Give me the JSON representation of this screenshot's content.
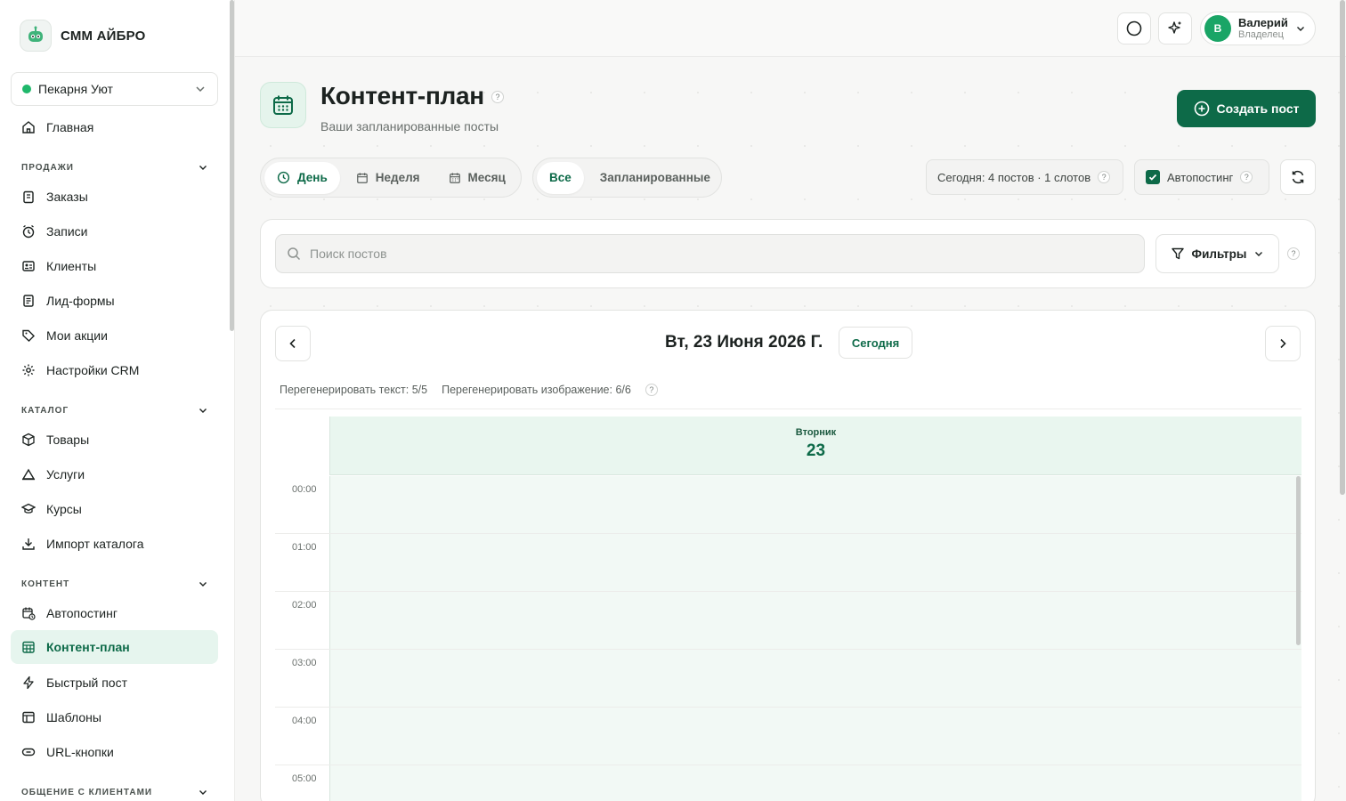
{
  "brand": {
    "name": "СММ АЙБРО"
  },
  "shop": {
    "name": "Пекарня Уют"
  },
  "nav": {
    "home": "Главная",
    "sections": {
      "sales": "ПРОДАЖИ",
      "catalog": "КАТАЛОГ",
      "content": "КОНТЕНТ",
      "clients": "ОБЩЕНИЕ С КЛИЕНТАМИ"
    },
    "sales_items": [
      "Заказы",
      "Записи",
      "Клиенты",
      "Лид-формы",
      "Мои акции",
      "Настройки CRM"
    ],
    "catalog_items": [
      "Товары",
      "Услуги",
      "Курсы",
      "Импорт каталога"
    ],
    "content_items": [
      "Автопостинг",
      "Контент-план",
      "Быстрый пост",
      "Шаблоны",
      "URL-кнопки"
    ],
    "active": "Контент-план"
  },
  "user": {
    "initial": "В",
    "name": "Валерий",
    "role": "Владелец"
  },
  "page": {
    "title": "Контент-план",
    "subtitle": "Ваши запланированные посты",
    "help": "?",
    "create_label": "Создать пост"
  },
  "view_tabs": {
    "day": "День",
    "week": "Неделя",
    "month": "Месяц",
    "selected": "День"
  },
  "status_tabs": {
    "all": "Все",
    "scheduled": "Запланированные",
    "selected": "Все"
  },
  "stats": {
    "today": "Сегодня: 4 постов · 1 слотов",
    "autoposting": "Автопостинг",
    "autoposting_checked": true
  },
  "search": {
    "placeholder": "Поиск постов",
    "value": ""
  },
  "filters": {
    "label": "Фильтры"
  },
  "calendar": {
    "date": "Вт, 23 Июня 2026 Г.",
    "today_label": "Сегодня",
    "regen_text": "Перегенерировать текст: 5/5",
    "regen_image": "Перегенерировать изображение: 6/6",
    "day_name": "Вторник",
    "day_num": "23",
    "hours": [
      "00:00",
      "01:00",
      "02:00",
      "03:00",
      "04:00",
      "05:00"
    ]
  },
  "colors": {
    "accent": "#0d6a48",
    "accent_light": "#e6f5ee",
    "online": "#1fb86b"
  }
}
